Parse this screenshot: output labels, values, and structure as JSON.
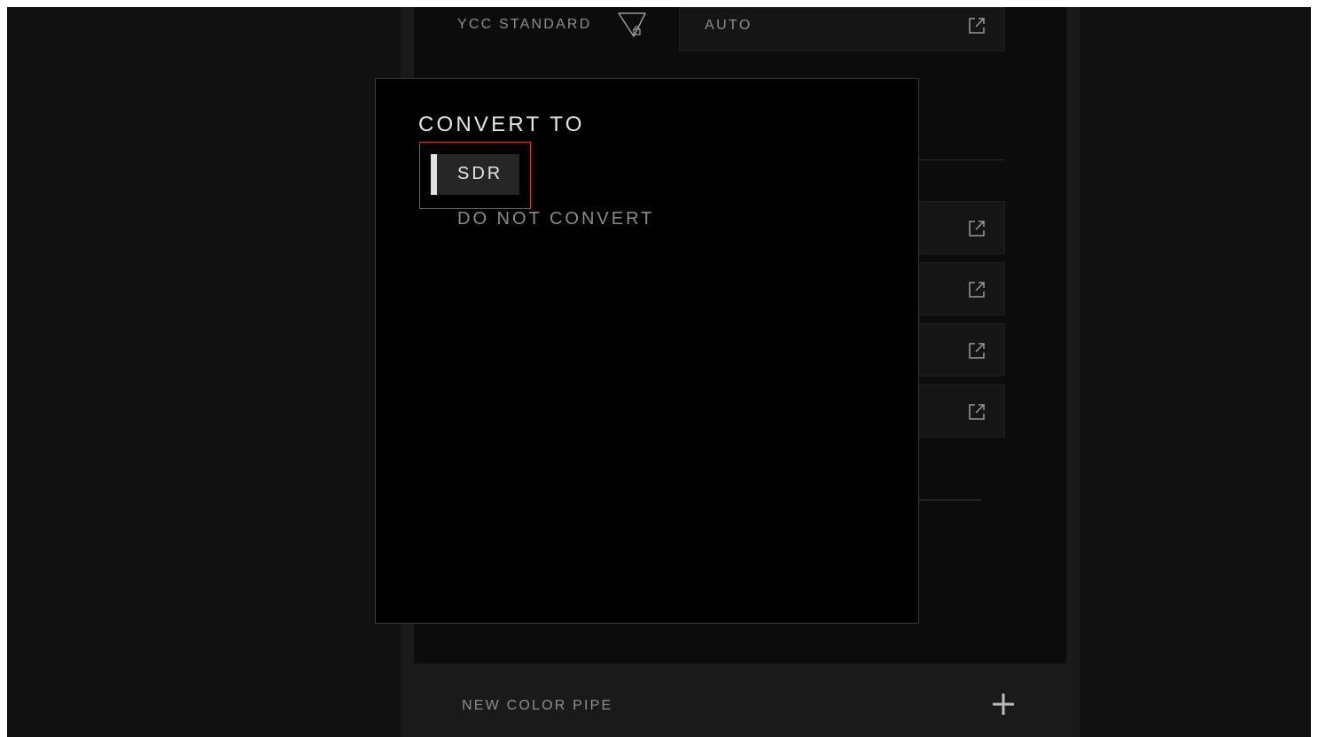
{
  "settings": {
    "ycc_standard_label": "YCC STANDARD",
    "ycc_standard_value": "AUTO",
    "lock_icon": "shield-lock-icon",
    "external_icon": "external-link-icon"
  },
  "footer": {
    "new_color_pipe_label": "NEW COLOR PIPE",
    "add_icon": "plus-icon"
  },
  "modal": {
    "title": "CONVERT TO",
    "options": [
      {
        "label": "SDR",
        "selected": true
      },
      {
        "label": "DO NOT CONVERT",
        "selected": false
      }
    ],
    "highlight_color": "#d93a1e"
  }
}
